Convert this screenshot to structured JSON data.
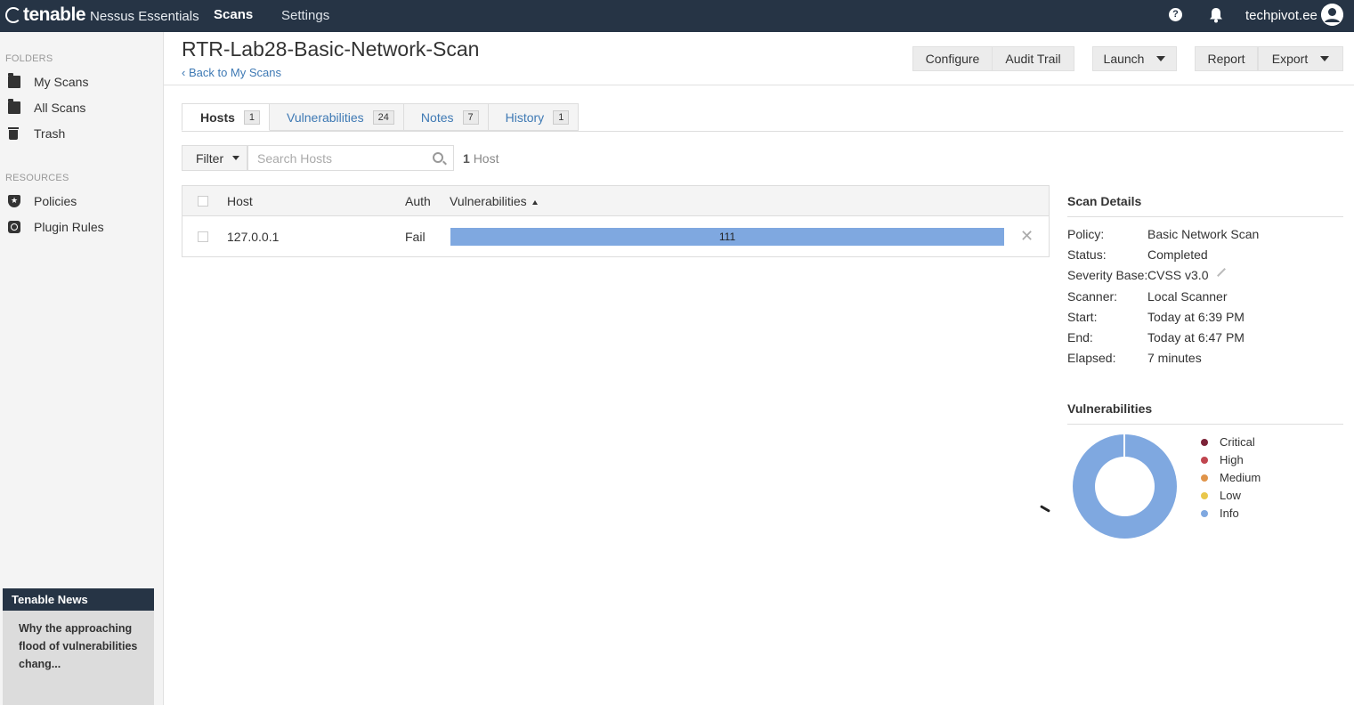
{
  "topbar": {
    "brand": "tenable",
    "product": "Nessus Essentials",
    "nav_scans": "Scans",
    "nav_settings": "Settings",
    "help_glyph": "?",
    "username": "techpivot.ee"
  },
  "sidebar": {
    "folders_heading": "FOLDERS",
    "my_scans": "My Scans",
    "all_scans": "All Scans",
    "trash": "Trash",
    "resources_heading": "RESOURCES",
    "policies": "Policies",
    "plugin_rules": "Plugin Rules",
    "news_title": "Tenable News",
    "news_text": "Why the approaching flood of vulnerabilities chang..."
  },
  "header": {
    "title": "RTR-Lab28-Basic-Network-Scan",
    "back_link": "Back to My Scans",
    "configure": "Configure",
    "audit_trail": "Audit Trail",
    "launch": "Launch",
    "report": "Report",
    "export": "Export"
  },
  "tabs": [
    {
      "label": "Hosts",
      "count": "1"
    },
    {
      "label": "Vulnerabilities",
      "count": "24"
    },
    {
      "label": "Notes",
      "count": "7"
    },
    {
      "label": "History",
      "count": "1"
    }
  ],
  "filter": {
    "label": "Filter",
    "placeholder": "Search Hosts",
    "count_num": "1",
    "count_text": "Host"
  },
  "table": {
    "col_host": "Host",
    "col_auth": "Auth",
    "col_vulns": "Vulnerabilities",
    "rows": [
      {
        "host": "127.0.0.1",
        "auth": "Fail",
        "vulns": "111"
      }
    ]
  },
  "scan_details": {
    "title": "Scan Details",
    "items": [
      {
        "label": "Policy:",
        "value": "Basic Network Scan"
      },
      {
        "label": "Status:",
        "value": "Completed"
      },
      {
        "label": "Severity Base:",
        "value": "CVSS v3.0"
      },
      {
        "label": "Scanner:",
        "value": "Local Scanner"
      },
      {
        "label": "Start:",
        "value": "Today at 6:39 PM"
      },
      {
        "label": "End:",
        "value": "Today at 6:47 PM"
      },
      {
        "label": "Elapsed:",
        "value": "7 minutes"
      }
    ]
  },
  "vuln_chart": {
    "title": "Vulnerabilities",
    "legend": [
      {
        "label": "Critical",
        "color": "#7c2338"
      },
      {
        "label": "High",
        "color": "#c0464f"
      },
      {
        "label": "Medium",
        "color": "#e0944a"
      },
      {
        "label": "Low",
        "color": "#e9c74b"
      },
      {
        "label": "Info",
        "color": "#7fa8e0"
      }
    ]
  },
  "colors": {
    "topbar": "#263445",
    "link": "#3e79b4",
    "info": "#7fa8e0"
  }
}
